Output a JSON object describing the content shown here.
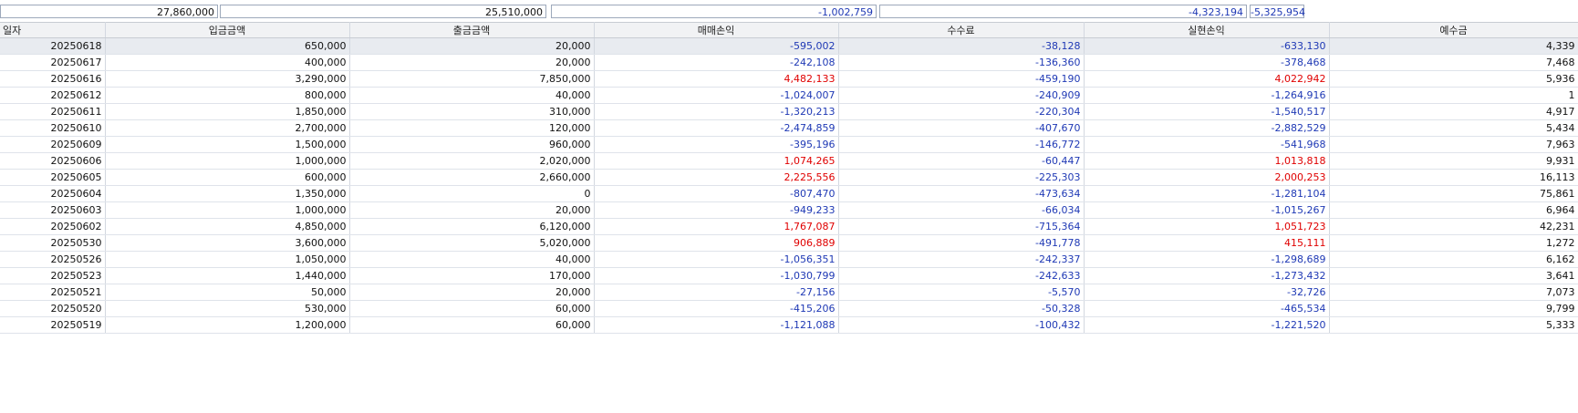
{
  "summary": {
    "top_fragments": [
      "입금금액",
      "출금금액",
      "매매손익",
      "실현손익",
      "예수금"
    ],
    "deposit_total": "27,860,000",
    "withdraw_total": "25,510,000",
    "trade_pl_total": "-1,002,759",
    "realized_pl_total": "-4,323,194",
    "extra_total": "-5,325,954"
  },
  "grid": {
    "columns": [
      "일자",
      "입금금액",
      "출금금액",
      "매매손익",
      "수수료",
      "실현손익",
      "예수금"
    ],
    "rows": [
      [
        "20250618",
        "650,000",
        "20,000",
        "-595,002",
        "-38,128",
        "-633,130",
        "4,339"
      ],
      [
        "20250617",
        "400,000",
        "20,000",
        "-242,108",
        "-136,360",
        "-378,468",
        "7,468"
      ],
      [
        "20250616",
        "3,290,000",
        "7,850,000",
        "4,482,133",
        "-459,190",
        "4,022,942",
        "5,936"
      ],
      [
        "20250612",
        "800,000",
        "40,000",
        "-1,024,007",
        "-240,909",
        "-1,264,916",
        "1"
      ],
      [
        "20250611",
        "1,850,000",
        "310,000",
        "-1,320,213",
        "-220,304",
        "-1,540,517",
        "4,917"
      ],
      [
        "20250610",
        "2,700,000",
        "120,000",
        "-2,474,859",
        "-407,670",
        "-2,882,529",
        "5,434"
      ],
      [
        "20250609",
        "1,500,000",
        "960,000",
        "-395,196",
        "-146,772",
        "-541,968",
        "7,963"
      ],
      [
        "20250606",
        "1,000,000",
        "2,020,000",
        "1,074,265",
        "-60,447",
        "1,013,818",
        "9,931"
      ],
      [
        "20250605",
        "600,000",
        "2,660,000",
        "2,225,556",
        "-225,303",
        "2,000,253",
        "16,113"
      ],
      [
        "20250604",
        "1,350,000",
        "0",
        "-807,470",
        "-473,634",
        "-1,281,104",
        "75,861"
      ],
      [
        "20250603",
        "1,000,000",
        "20,000",
        "-949,233",
        "-66,034",
        "-1,015,267",
        "6,964"
      ],
      [
        "20250602",
        "4,850,000",
        "6,120,000",
        "1,767,087",
        "-715,364",
        "1,051,723",
        "42,231"
      ],
      [
        "20250530",
        "3,600,000",
        "5,020,000",
        "906,889",
        "-491,778",
        "415,111",
        "1,272"
      ],
      [
        "20250526",
        "1,050,000",
        "40,000",
        "-1,056,351",
        "-242,337",
        "-1,298,689",
        "6,162"
      ],
      [
        "20250523",
        "1,440,000",
        "170,000",
        "-1,030,799",
        "-242,633",
        "-1,273,432",
        "3,641"
      ],
      [
        "20250521",
        "50,000",
        "20,000",
        "-27,156",
        "-5,570",
        "-32,726",
        "7,073"
      ],
      [
        "20250520",
        "530,000",
        "60,000",
        "-415,206",
        "-50,328",
        "-465,534",
        "9,799"
      ],
      [
        "20250519",
        "1,200,000",
        "60,000",
        "-1,121,088",
        "-100,432",
        "-1,221,520",
        "5,333"
      ]
    ]
  },
  "colors": {
    "negative": "#1f39b5",
    "positive": "#e00000",
    "plain": "#111111"
  }
}
